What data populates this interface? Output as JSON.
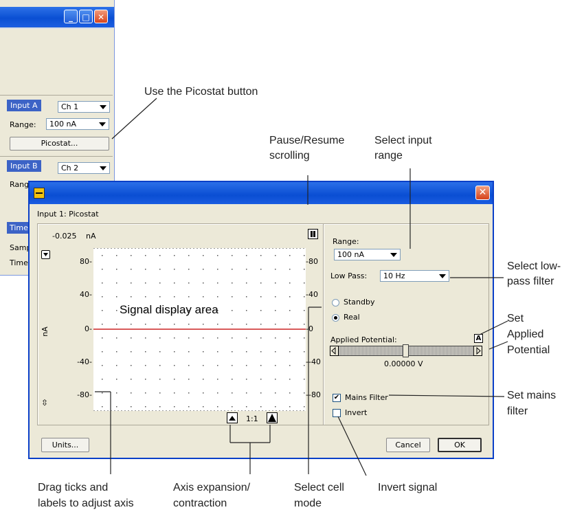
{
  "bg_window": {
    "input_a_label": "Input A",
    "input_a_channel": "Ch 1",
    "range_label": "Range:",
    "range_value": "100 nA",
    "picostat_button": "Picostat...",
    "input_b_label": "Input B",
    "input_b_channel": "Ch 2",
    "range_b_label": "Rang",
    "time_label": "Time",
    "samp_label": "Samp",
    "time2_label": "Time",
    "minimize": "_",
    "maximize": "□",
    "close": "✕"
  },
  "dialog": {
    "close": "✕",
    "heading": "Input 1: Picostat",
    "top_value": "-0.025",
    "top_unit": "nA",
    "y_unit": "nA",
    "y_ticks_left": [
      "80-",
      "40-",
      "0-",
      "-40-",
      "-80-"
    ],
    "y_ticks_right": [
      "-80",
      "-40",
      "-0",
      "--40",
      "--80"
    ],
    "zoom_ratio": "1:1",
    "units_button": "Units...",
    "range_label": "Range:",
    "range_value": "100 nA",
    "lowpass_label": "Low Pass:",
    "lowpass_value": "10 Hz",
    "standby_label": "Standby",
    "real_label": "Real",
    "applied_potential_label": "Applied Potential:",
    "applied_potential_value": "0.00000 V",
    "mains_filter_label": "Mains Filter",
    "invert_label": "Invert",
    "cancel_button": "Cancel",
    "ok_button": "OK",
    "signal_label": "Signal display area",
    "lock_glyph": "A",
    "mains_checked": "✔"
  },
  "annotations": {
    "picostat": "Use the Picostat button",
    "pause": [
      "Pause/Resume",
      "scrolling"
    ],
    "input_range": [
      "Select input",
      "range"
    ],
    "lowpass": [
      "Select low-",
      "pass filter"
    ],
    "applied": [
      "Set",
      "Applied",
      "Potential"
    ],
    "mains": [
      "Set mains",
      "filter"
    ],
    "drag": [
      "Drag ticks and",
      "labels to adjust axis"
    ],
    "axis": [
      "Axis expansion/",
      "contraction"
    ],
    "cell": [
      "Select cell",
      "mode"
    ],
    "invert": "Invert signal"
  }
}
